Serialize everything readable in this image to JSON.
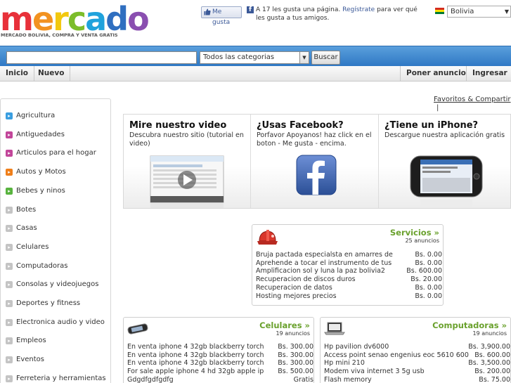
{
  "logo": {
    "text": "mercado",
    "tagline": "MERCADO BOLIVIA, COMPRA Y VENTA GRATIS"
  },
  "social": {
    "like_label": "Me gusta",
    "text_before": "A 17 les gusta una página.",
    "register_link": "Regístrate",
    "text_after": "para ver qué les gusta a tus amigos."
  },
  "country": {
    "selected": "Bolivia",
    "flag_colors": [
      "#d52b1e",
      "#f9e300",
      "#007934"
    ]
  },
  "search": {
    "value": "",
    "category_selected": "Todos las categorias",
    "button_label": "Buscar"
  },
  "nav": {
    "left": [
      "Inicio",
      "Nuevo"
    ],
    "right": [
      "Poner anuncio",
      "Ingresar"
    ]
  },
  "sidebar": {
    "categories": [
      {
        "label": "Agricultura",
        "color": "#3a9ee0",
        "icon": "arrow-icon"
      },
      {
        "label": "Antiguedades",
        "color": "#c2469a",
        "icon": "arrow-icon"
      },
      {
        "label": "Articulos para el hogar",
        "color": "#c2469a",
        "icon": "arrow-icon"
      },
      {
        "label": "Autos y Motos",
        "color": "#ef7f1a",
        "icon": "arrow-icon"
      },
      {
        "label": "Bebes y ninos",
        "color": "#58b33e",
        "icon": "arrow-icon"
      },
      {
        "label": "Botes",
        "color": "#c4c4c4",
        "icon": "arrow-icon"
      },
      {
        "label": "Casas",
        "color": "#c4c4c4",
        "icon": "arrow-icon"
      },
      {
        "label": "Celulares",
        "color": "#c4c4c4",
        "icon": "arrow-icon"
      },
      {
        "label": "Computadoras",
        "color": "#c4c4c4",
        "icon": "arrow-icon"
      },
      {
        "label": "Consolas y videojuegos",
        "color": "#c4c4c4",
        "icon": "arrow-icon"
      },
      {
        "label": "Deportes y fitness",
        "color": "#c4c4c4",
        "icon": "arrow-icon"
      },
      {
        "label": "Electronica audio y video",
        "color": "#c4c4c4",
        "icon": "arrow-icon"
      },
      {
        "label": "Empleos",
        "color": "#c4c4c4",
        "icon": "arrow-icon"
      },
      {
        "label": "Eventos",
        "color": "#c4c4c4",
        "icon": "arrow-icon"
      },
      {
        "label": "Ferreteria y herramientas",
        "color": "#c4c4c4",
        "icon": "arrow-icon"
      }
    ]
  },
  "favorites_link": "Favoritos & Compartir",
  "favorites_separator": "|",
  "promo": [
    {
      "title": "Mire nuestro video",
      "text": "Descubra nuestro sitio (tutorial en video)",
      "icon": "video-player-icon"
    },
    {
      "title": "¿Usas Facebook?",
      "text": "Porfavor Apoyanos! haz click en el boton - Me gusta - encima.",
      "icon": "facebook-logo-icon"
    },
    {
      "title": "¿Tiene un iPhone?",
      "text": "Descargue nuestra aplicación gratis",
      "icon": "iphone-icon"
    }
  ],
  "servicios": {
    "title": "Servicios »",
    "count": "25 anuncios",
    "icon": "hard-hat-icon",
    "items": [
      {
        "name": "Bruja pactada especialsta en amarres de",
        "price": "Bs. 0.00"
      },
      {
        "name": "Aprehende a tocar el instrumento de tus",
        "price": "Bs. 0.00"
      },
      {
        "name": "Amplificacion sol y luna la paz bolivia2",
        "price": "Bs. 600.00"
      },
      {
        "name": "Recuperacion de discos duros",
        "price": "Bs. 20.00"
      },
      {
        "name": "Recuperacion de datos",
        "price": "Bs. 0.00"
      },
      {
        "name": "Hosting mejores precios",
        "price": "Bs. 0.00"
      }
    ]
  },
  "celulares": {
    "title": "Celulares »",
    "count": "19 anuncios",
    "icon": "phone-icon",
    "items": [
      {
        "name": "En venta iphone 4 32gb blackberry torch",
        "price": "Bs. 300.00"
      },
      {
        "name": "En venta iphone 4 32gb blackberry torch",
        "price": "Bs. 300.00"
      },
      {
        "name": "En venta iphone 4 32gb blackberry torch",
        "price": "Bs. 300.00"
      },
      {
        "name": "For sale apple iphone 4 hd 32gb apple ip",
        "price": "Bs. 500.00"
      },
      {
        "name": "Gdgdfgdfgdfg",
        "price": "Gratis"
      }
    ]
  },
  "computadoras": {
    "title": "Computadoras »",
    "count": "19 anuncios",
    "icon": "laptop-icon",
    "items": [
      {
        "name": "Hp pavilion dv6000",
        "price": "Bs. 3,900.00"
      },
      {
        "name": "Access point senao engenius eoc 5610 600",
        "price": "Bs. 600.00"
      },
      {
        "name": "Hp mini 210",
        "price": "Bs. 3,500.00"
      },
      {
        "name": "Modem viva internet 3 5g usb",
        "price": "Bs. 200.00"
      },
      {
        "name": "Flash memory",
        "price": "Bs. 75.00"
      }
    ]
  }
}
